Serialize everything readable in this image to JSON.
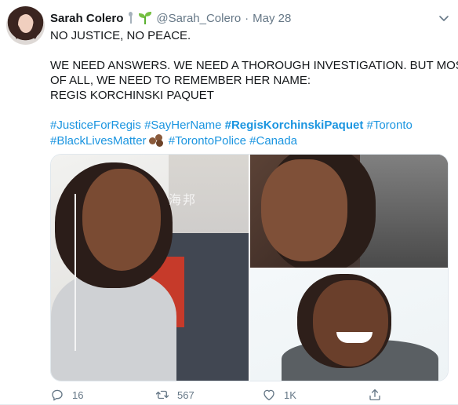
{
  "tweet": {
    "author_name": "Sarah Colero",
    "author_handle": "@Sarah_Colero",
    "separator": "·",
    "date": "May 28",
    "text_lines": [
      "NO JUSTICE, NO PEACE.",
      "WE NEED ANSWERS. WE NEED A THOROUGH INVESTIGATION. BUT MOST",
      "OF ALL, WE NEED TO REMEMBER HER NAME:",
      "REGIS KORCHINSKI PAQUET"
    ],
    "hashtags_line1": [
      "#JusticeForRegis",
      "#SayHerName",
      "#RegisKorchinskiPaquet",
      "#Toronto"
    ],
    "hashtags_line2": [
      "#BlackLivesMatter",
      "#TorontoPolice",
      "#Canada"
    ],
    "media_watermark": "海邦",
    "actions": {
      "reply_count": "16",
      "retweet_count": "567",
      "like_count": "1K"
    },
    "icons": [
      "avatar",
      "pushpin-emoji-icon",
      "seedling-emoji-icon",
      "chevron-down-icon",
      "folded-hands-emoji-icon",
      "reply-icon",
      "retweet-icon",
      "like-icon",
      "share-icon"
    ],
    "colors": {
      "link": "#1b95e0",
      "muted": "#657786",
      "text": "#14171a"
    }
  }
}
